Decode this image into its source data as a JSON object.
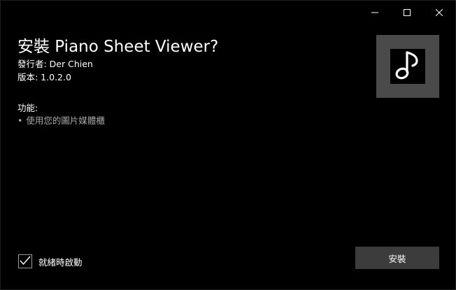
{
  "window": {
    "caption_buttons": {
      "minimize_icon": "minimize-icon",
      "maximize_icon": "maximize-icon",
      "close_icon": "close-icon"
    }
  },
  "app": {
    "title": "安裝 Piano Sheet Viewer?",
    "publisher": "發行者: Der Chien",
    "version": "版本: 1.0.2.0",
    "icon": "music-note-icon"
  },
  "capabilities": {
    "heading": "功能:",
    "items": [
      {
        "bullet": "•",
        "label": "使用您的圖片媒體櫃"
      }
    ]
  },
  "launch_when_ready": {
    "label": "就緒時啟動",
    "checked": true
  },
  "actions": {
    "install_label": "安裝"
  },
  "colors": {
    "background": "#000000",
    "tile": "#4a4a4a",
    "button": "#3c3c3c",
    "muted_text": "#a8a8a8"
  }
}
